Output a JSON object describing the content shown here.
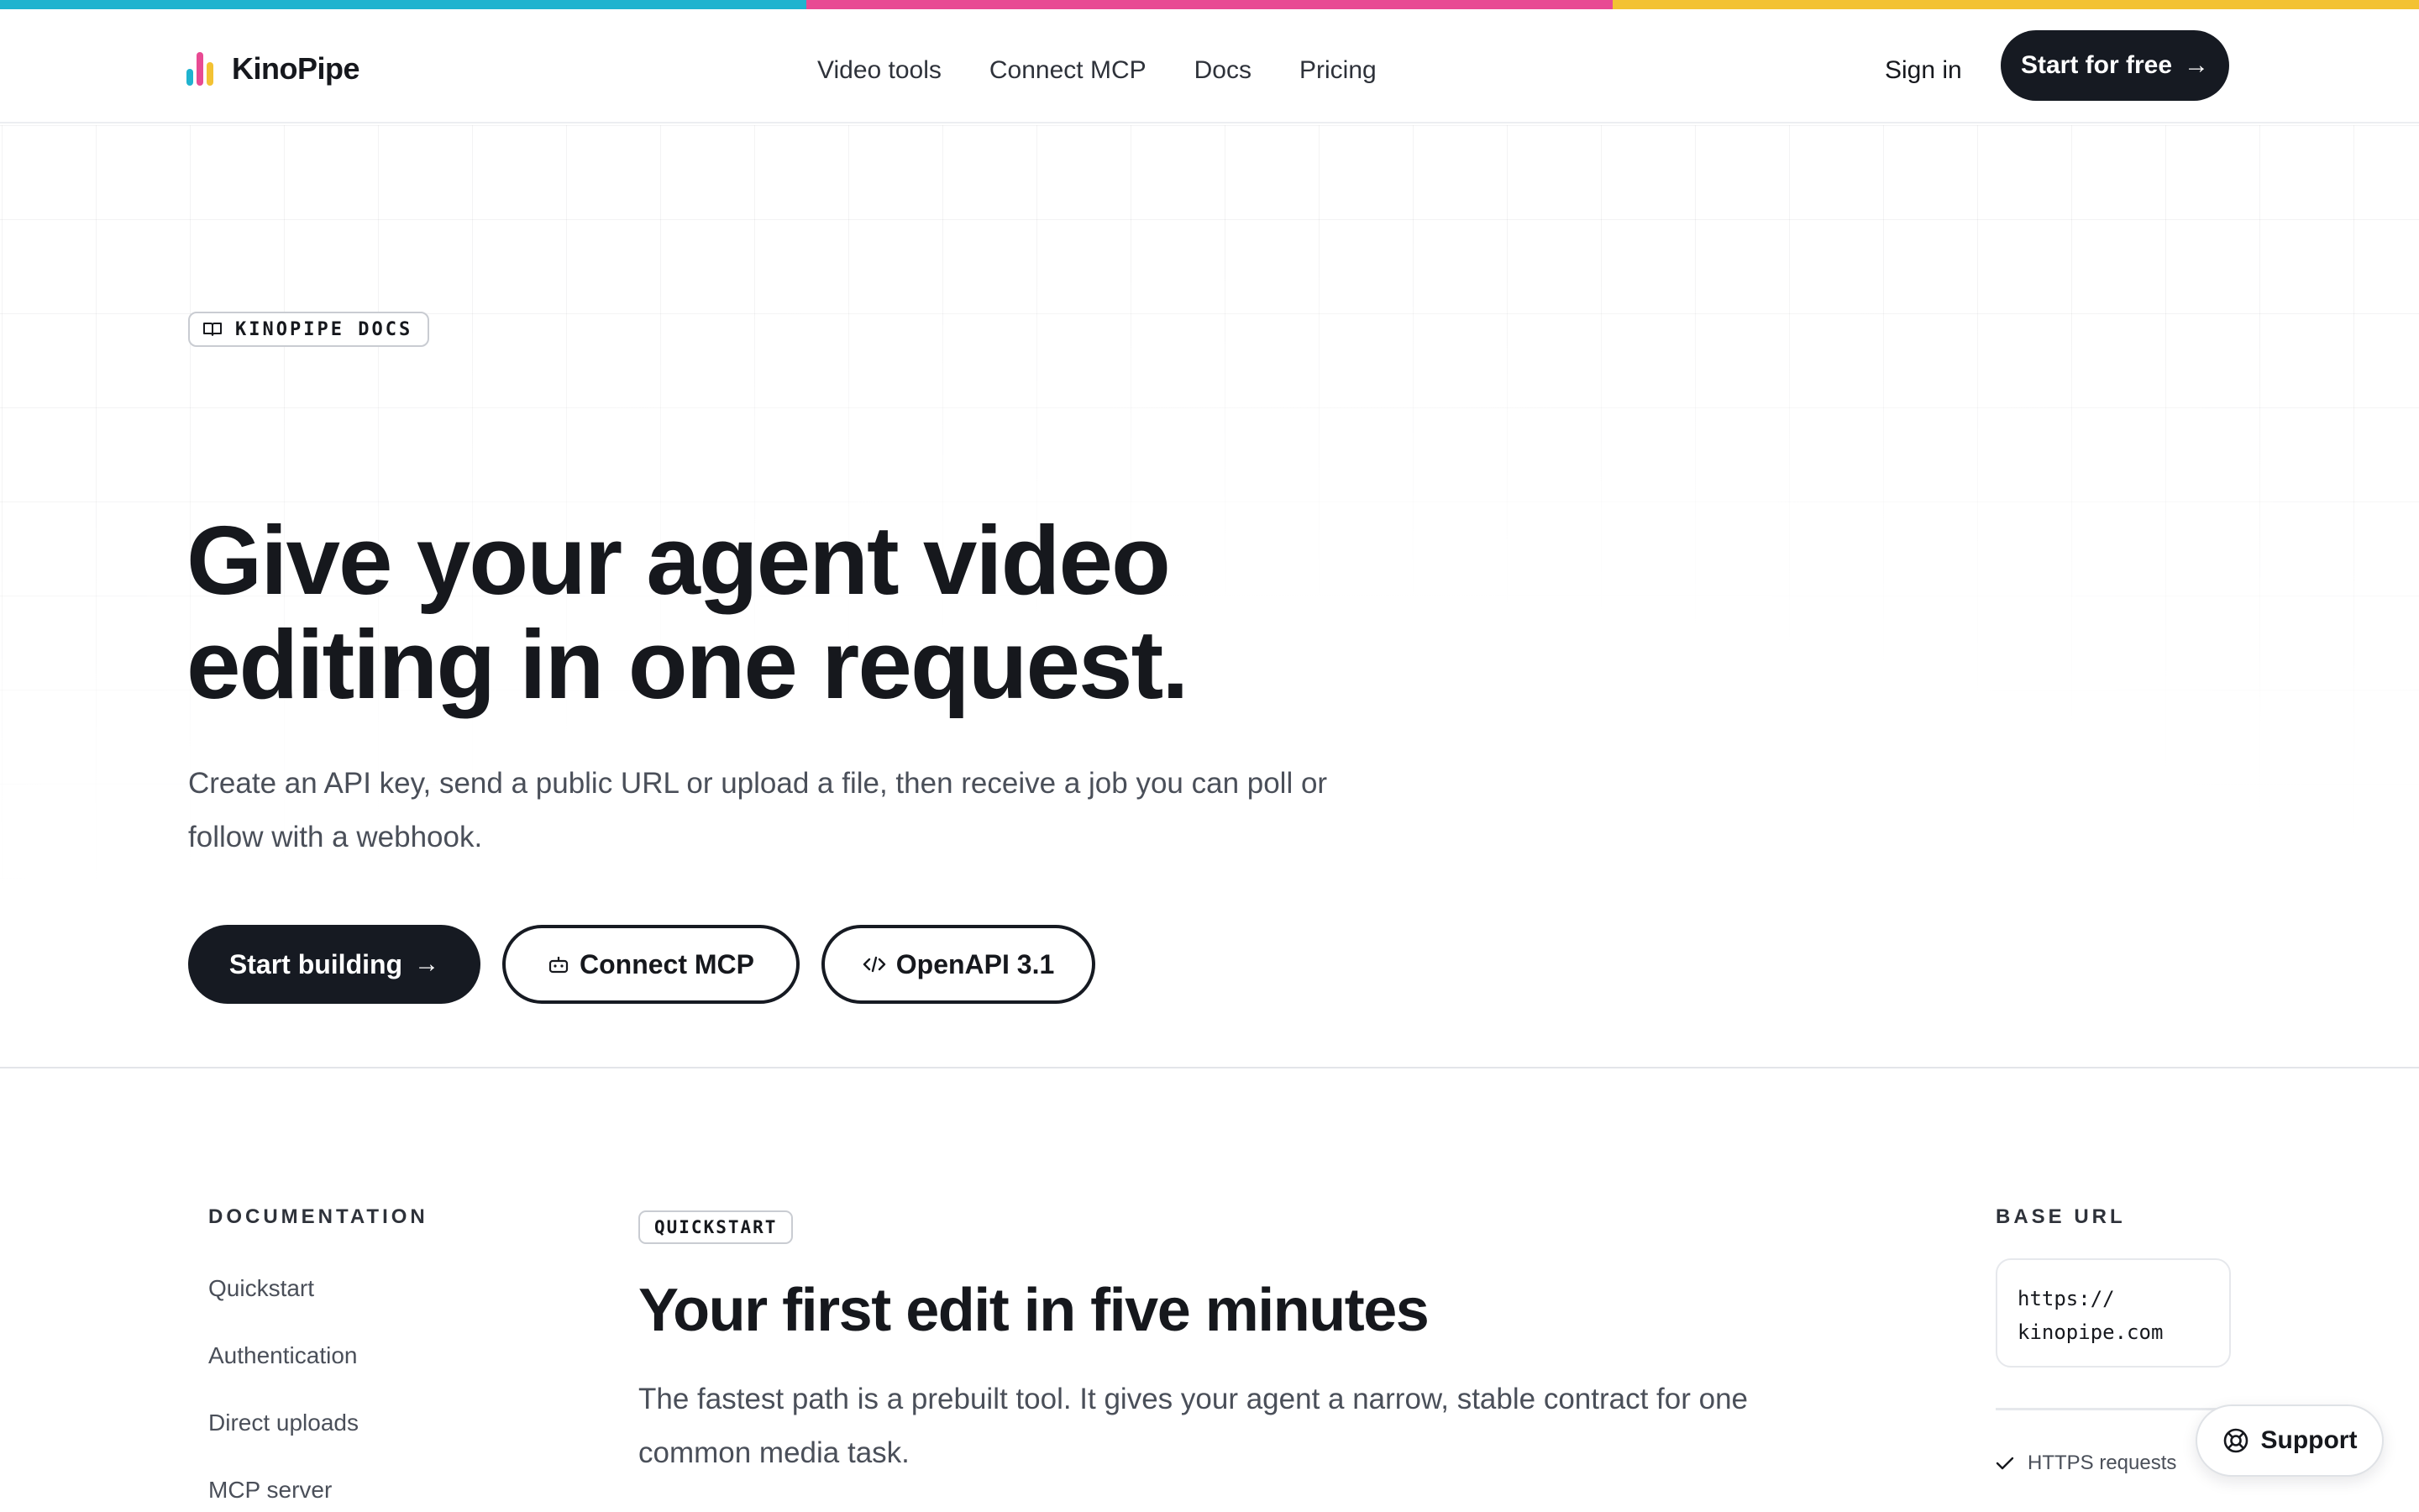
{
  "colors": {
    "stripe_blue": "#1fb3cf",
    "stripe_pink": "#e84a93",
    "stripe_yellow": "#f3c233",
    "ink": "#161a22"
  },
  "header": {
    "brand": "KinoPipe",
    "nav": [
      "Video tools",
      "Connect MCP",
      "Docs",
      "Pricing"
    ],
    "signin": "Sign in",
    "cta": "Start for free"
  },
  "hero": {
    "badge": "KINOPIPE DOCS",
    "badge_icon": "book-icon",
    "title_line1": "Give your agent video",
    "title_line2": "editing in one request.",
    "subtitle": "Create an API key, send a public URL or upload a file, then receive a job you can poll or follow with a webhook.",
    "actions": {
      "primary": "Start building",
      "mcp": "Connect MCP",
      "openapi": "OpenAPI 3.1"
    }
  },
  "sidebar": {
    "heading": "DOCUMENTATION",
    "items": [
      "Quickstart",
      "Authentication",
      "Direct uploads",
      "MCP server"
    ]
  },
  "main": {
    "badge": "QUICKSTART",
    "title": "Your first edit in five minutes",
    "body": "The fastest path is a prebuilt tool. It gives your agent a narrow, stable contract for one common media task."
  },
  "aside": {
    "heading": "BASE URL",
    "url_line1": "https://",
    "url_line2": "kinopipe.com",
    "check_item": "HTTPS requests"
  },
  "support": {
    "label": "Support",
    "icon": "lifebuoy-icon"
  }
}
